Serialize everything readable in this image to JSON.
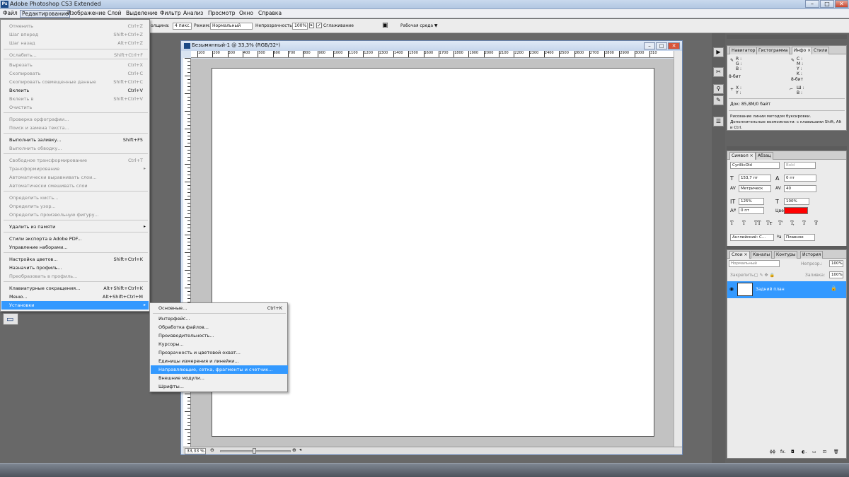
{
  "app": {
    "title": "Adobe Photoshop CS3 Extended",
    "logo": "Ps"
  },
  "window_controls": {
    "minimize": "–",
    "maximize": "□",
    "close": "✕"
  },
  "menubar": [
    "Файл",
    "Редактирование",
    "Изображение",
    "Слой",
    "Выделение",
    "Фильтр",
    "Анализ",
    "Просмотр",
    "Окно",
    "Справка"
  ],
  "options": {
    "width_label": "олщина:",
    "width_value": "4 пикс.",
    "mode_label": "Режим:",
    "mode_value": "Нормальный",
    "opacity_label": "Непрозрачность:",
    "opacity_value": "100%",
    "antialias_label": "Сглаживание",
    "workspace_label": "Рабочая среда ▼"
  },
  "edit_menu": [
    {
      "label": "Отменить",
      "shortcut": "Ctrl+Z",
      "disabled": true
    },
    {
      "label": "Шаг вперед",
      "shortcut": "Shift+Ctrl+Z",
      "disabled": true
    },
    {
      "label": "Шаг назад",
      "shortcut": "Alt+Ctrl+Z",
      "disabled": true
    },
    {
      "label": "Ослабить...",
      "shortcut": "Shift+Ctrl+F",
      "disabled": true
    },
    {
      "label": "Вырезать",
      "shortcut": "Ctrl+X",
      "disabled": true
    },
    {
      "label": "Скопировать",
      "shortcut": "Ctrl+C",
      "disabled": true
    },
    {
      "label": "Скопировать совмещенные данные",
      "shortcut": "Shift+Ctrl+C",
      "disabled": true
    },
    {
      "label": "Вклеить",
      "shortcut": "Ctrl+V",
      "disabled": false
    },
    {
      "label": "Вклеить в",
      "shortcut": "Shift+Ctrl+V",
      "disabled": true
    },
    {
      "label": "Очистить",
      "shortcut": "",
      "disabled": true
    },
    {
      "label": "Проверка орфографии...",
      "shortcut": "",
      "disabled": true
    },
    {
      "label": "Поиск и замена текста...",
      "shortcut": "",
      "disabled": true
    },
    {
      "label": "Выполнить заливку...",
      "shortcut": "Shift+F5",
      "disabled": false
    },
    {
      "label": "Выполнить обводку...",
      "shortcut": "",
      "disabled": true
    },
    {
      "label": "Свободное трансформирование",
      "shortcut": "Ctrl+T",
      "disabled": true
    },
    {
      "label": "Трансформирование",
      "shortcut": "",
      "disabled": true
    },
    {
      "label": "Автоматически выравнивать слои...",
      "shortcut": "",
      "disabled": true
    },
    {
      "label": "Автоматически смешивать слои",
      "shortcut": "",
      "disabled": true
    },
    {
      "label": "Определить кисть...",
      "shortcut": "",
      "disabled": true
    },
    {
      "label": "Определить узор...",
      "shortcut": "",
      "disabled": true
    },
    {
      "label": "Определить произвольную фигуру...",
      "shortcut": "",
      "disabled": true
    },
    {
      "label": "Удалить из памяти",
      "shortcut": "",
      "disabled": false
    },
    {
      "label": "Стили экспорта в Adobe PDF...",
      "shortcut": "",
      "disabled": false
    },
    {
      "label": "Управление наборами...",
      "shortcut": "",
      "disabled": false
    },
    {
      "label": "Настройка цветов...",
      "shortcut": "Shift+Ctrl+K",
      "disabled": false
    },
    {
      "label": "Назначить профиль...",
      "shortcut": "",
      "disabled": false
    },
    {
      "label": "Преобразовать в профиль...",
      "shortcut": "",
      "disabled": true
    },
    {
      "label": "Клавиатурные сокращения...",
      "shortcut": "Alt+Shift+Ctrl+K",
      "disabled": false
    },
    {
      "label": "Меню...",
      "shortcut": "Alt+Shift+Ctrl+M",
      "disabled": false
    },
    {
      "label": "Установки",
      "shortcut": "",
      "disabled": false
    }
  ],
  "prefs_menu": [
    {
      "label": "Основные...",
      "shortcut": "Ctrl+K"
    },
    {
      "label": "Интерфейс...",
      "shortcut": ""
    },
    {
      "label": "Обработка файлов...",
      "shortcut": ""
    },
    {
      "label": "Производительность...",
      "shortcut": ""
    },
    {
      "label": "Курсоры...",
      "shortcut": ""
    },
    {
      "label": "Прозрачность и цветовой охват...",
      "shortcut": ""
    },
    {
      "label": "Единицы измерения и линейки...",
      "shortcut": ""
    },
    {
      "label": "Направляющие, сетка, фрагменты и счетчик...",
      "shortcut": ""
    },
    {
      "label": "Внешние модули...",
      "shortcut": ""
    },
    {
      "label": "Шрифты...",
      "shortcut": ""
    }
  ],
  "document": {
    "title": "Безымянный-1 @ 33,3% (RGB/32*)",
    "zoom": "33,33 %",
    "ruler_labels": [
      "100",
      "200",
      "300",
      "400",
      "500",
      "600",
      "700",
      "800",
      "900",
      "1000",
      "1100",
      "1200",
      "1300",
      "1400",
      "1500",
      "1600",
      "1700",
      "1800",
      "1900",
      "2000",
      "2100",
      "2200",
      "2300",
      "2400",
      "2500",
      "2600",
      "2700",
      "2800",
      "2900",
      "3000",
      "310"
    ]
  },
  "info_panel": {
    "tabs": [
      "Навигатор",
      "Гистограмма",
      "Инфо ×",
      "Стили"
    ],
    "r": "R :",
    "g": "G :",
    "b": "B :",
    "c": "C :",
    "m": "M :",
    "y": "Y :",
    "k": "K :",
    "bit1": "8-бит",
    "bit2": "8-бит",
    "x": "X :",
    "yy": "Y :",
    "w": "Ш :",
    "h": "В :",
    "doc": "Док: 85,8M/0 байт",
    "hint": "Рисование линии методом буксировки. Дополнительные возможности: с клавишами Shift, Alt и Ctrl."
  },
  "char_panel": {
    "tabs": [
      "Символ ×",
      "Абзац"
    ],
    "font": "CyrillicOld",
    "style": "Bold",
    "size": "153,7 пт",
    "leading": "0 пт",
    "kerning": "Метрическ",
    "tracking": "40",
    "vscale": "125%",
    "hscale": "100%",
    "baseline": "0 пт",
    "color_label": "Цвет:",
    "color": "#ff0000",
    "language": "Английский: С...",
    "aa_label": "ªa",
    "aa": "Плавное",
    "style_buttons": [
      "T",
      "T",
      "TT",
      "Tт",
      "T'",
      "T,",
      "T",
      "Ŧ"
    ]
  },
  "layers_panel": {
    "tabs": [
      "Слои ×",
      "Каналы",
      "Контуры",
      "История"
    ],
    "blend": "Нормальный",
    "opacity_label": "Непрозр.:",
    "opacity": "100%",
    "lock_label": "Закрепить:",
    "fill_label": "Заливка:",
    "fill": "100%",
    "layer_name": "Задний план",
    "bottom_icons": [
      "ɸɸ",
      "fx.",
      "◘",
      "◐.",
      "▭",
      "⊡",
      "🗑"
    ]
  }
}
